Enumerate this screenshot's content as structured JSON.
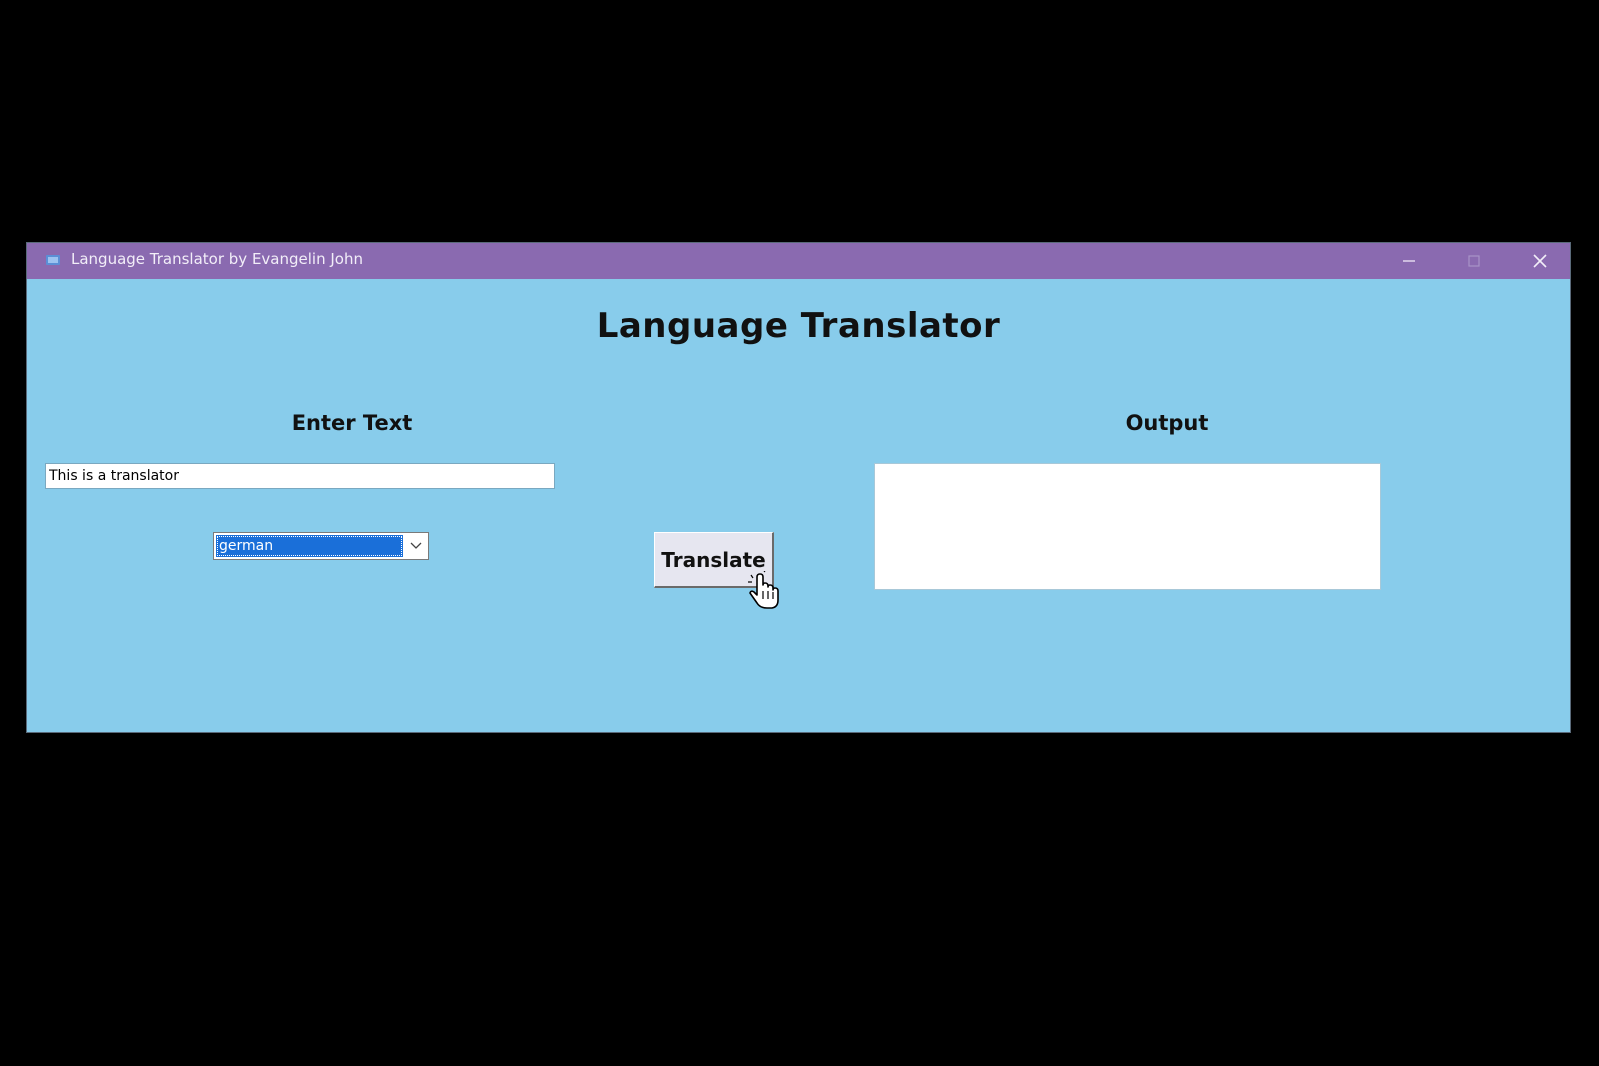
{
  "window": {
    "title": "Language Translator by Evangelin John",
    "controls": {
      "minimize_icon": "minimize-icon",
      "maximize_icon": "maximize-icon",
      "close_icon": "close-icon"
    },
    "titlebar_color": "#8a6ab0",
    "background_color": "#88cceb"
  },
  "main": {
    "heading": "Language Translator",
    "input_label": "Enter Text",
    "input_value": "This is a translator",
    "language_select": {
      "selected": "german"
    },
    "translate_button": "Translate",
    "output_label": "Output",
    "output_value": ""
  },
  "colors": {
    "selection": "#1a6fd9",
    "button_face": "#e6e6f0"
  }
}
